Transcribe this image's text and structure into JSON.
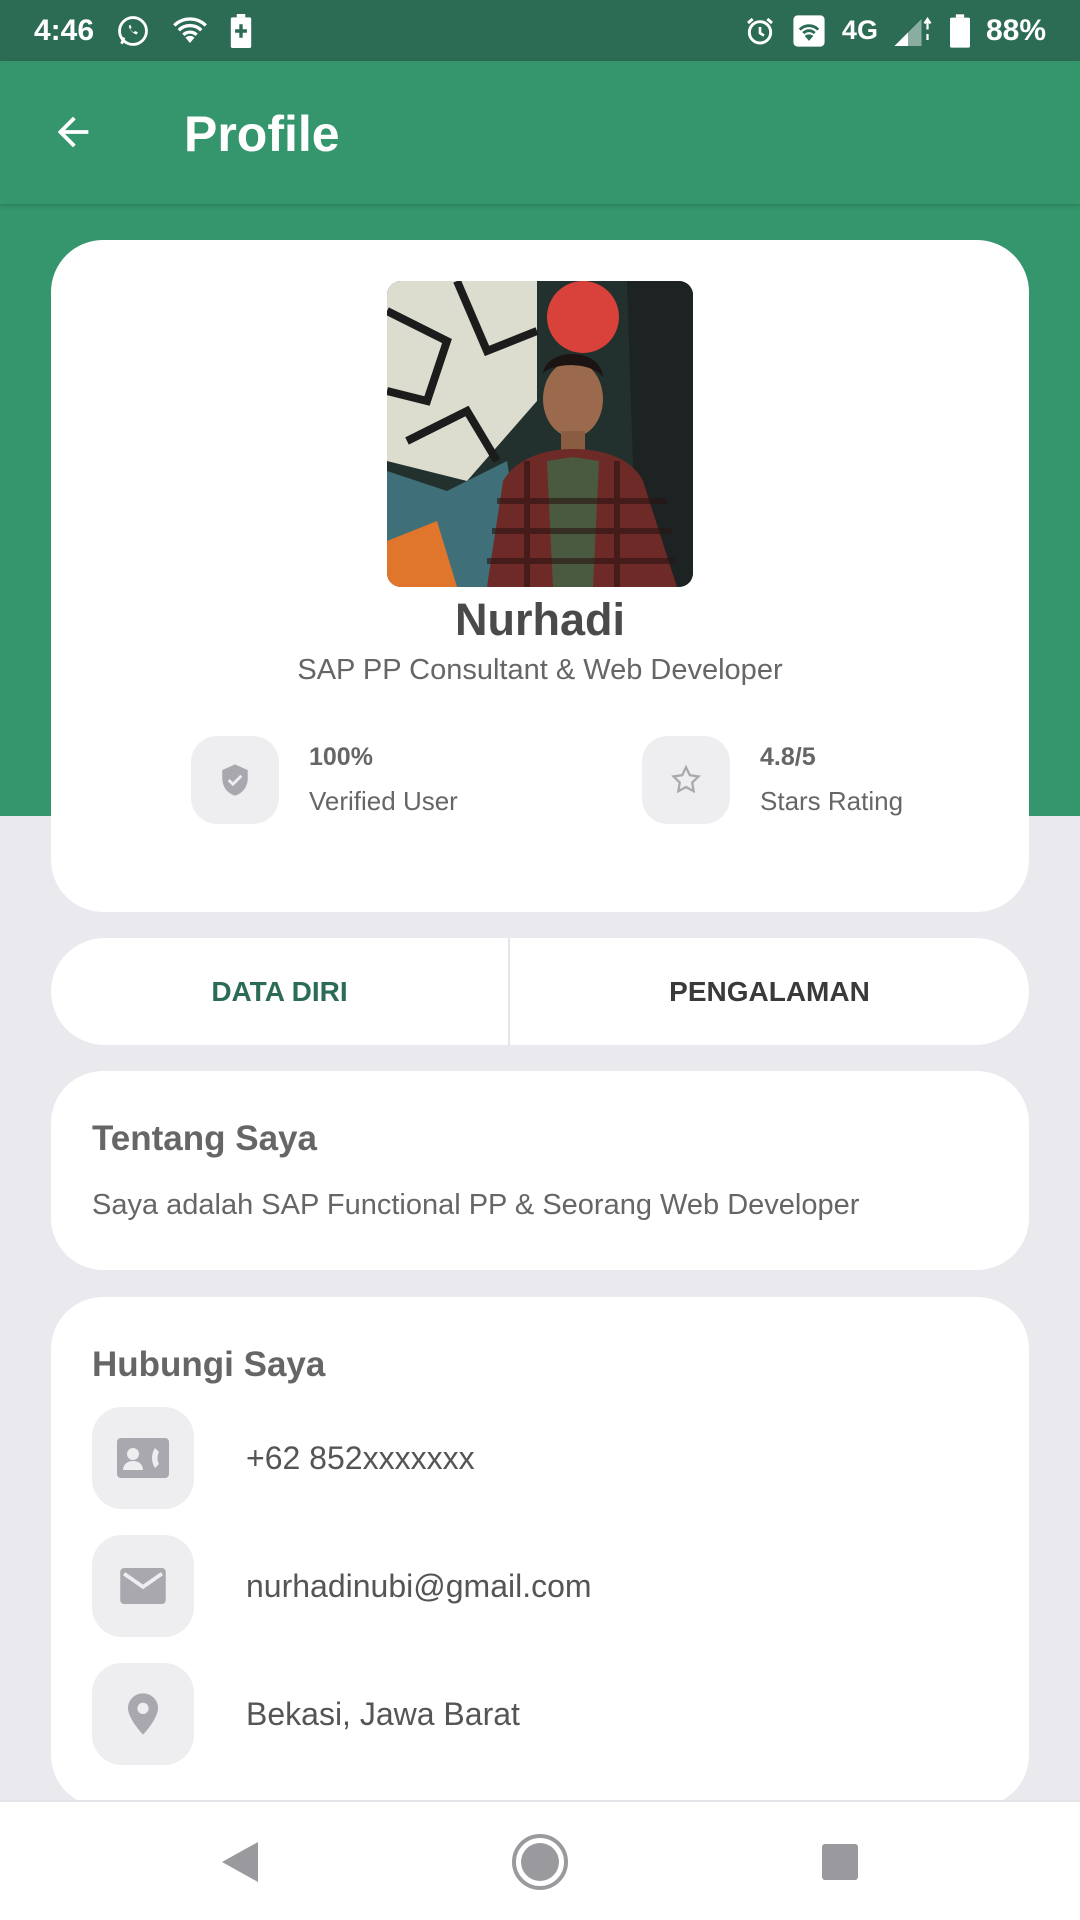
{
  "status_bar": {
    "time": "4:46",
    "network": "4G",
    "battery": "88%"
  },
  "app_bar": {
    "title": "Profile"
  },
  "profile": {
    "name": "Nurhadi",
    "role": "SAP PP Consultant & Web Developer",
    "verified_value": "100%",
    "verified_label": "Verified User",
    "rating_value": "4.8/5",
    "rating_label": "Stars Rating"
  },
  "tabs": [
    {
      "label": "DATA DIRI"
    },
    {
      "label": "PENGALAMAN"
    }
  ],
  "about": {
    "title": "Tentang Saya",
    "text": "Saya adalah SAP Functional PP & Seorang Web Developer"
  },
  "contact": {
    "title": "Hubungi Saya",
    "phone": "+62 852xxxxxxx",
    "email": "nurhadinubi@gmail.com",
    "location": "Bekasi, Jawa Barat"
  },
  "colors": {
    "primary": "#35956d",
    "status_bar": "#2c6b54",
    "active_tab": "#2c6b54",
    "background": "#e9e9ee"
  },
  "icons": {
    "app_back": "arrow-left-icon",
    "verified": "shield-check-icon",
    "rating": "star-outline-icon",
    "phone": "contact-card-icon",
    "email": "envelope-icon",
    "location": "map-pin-icon"
  }
}
